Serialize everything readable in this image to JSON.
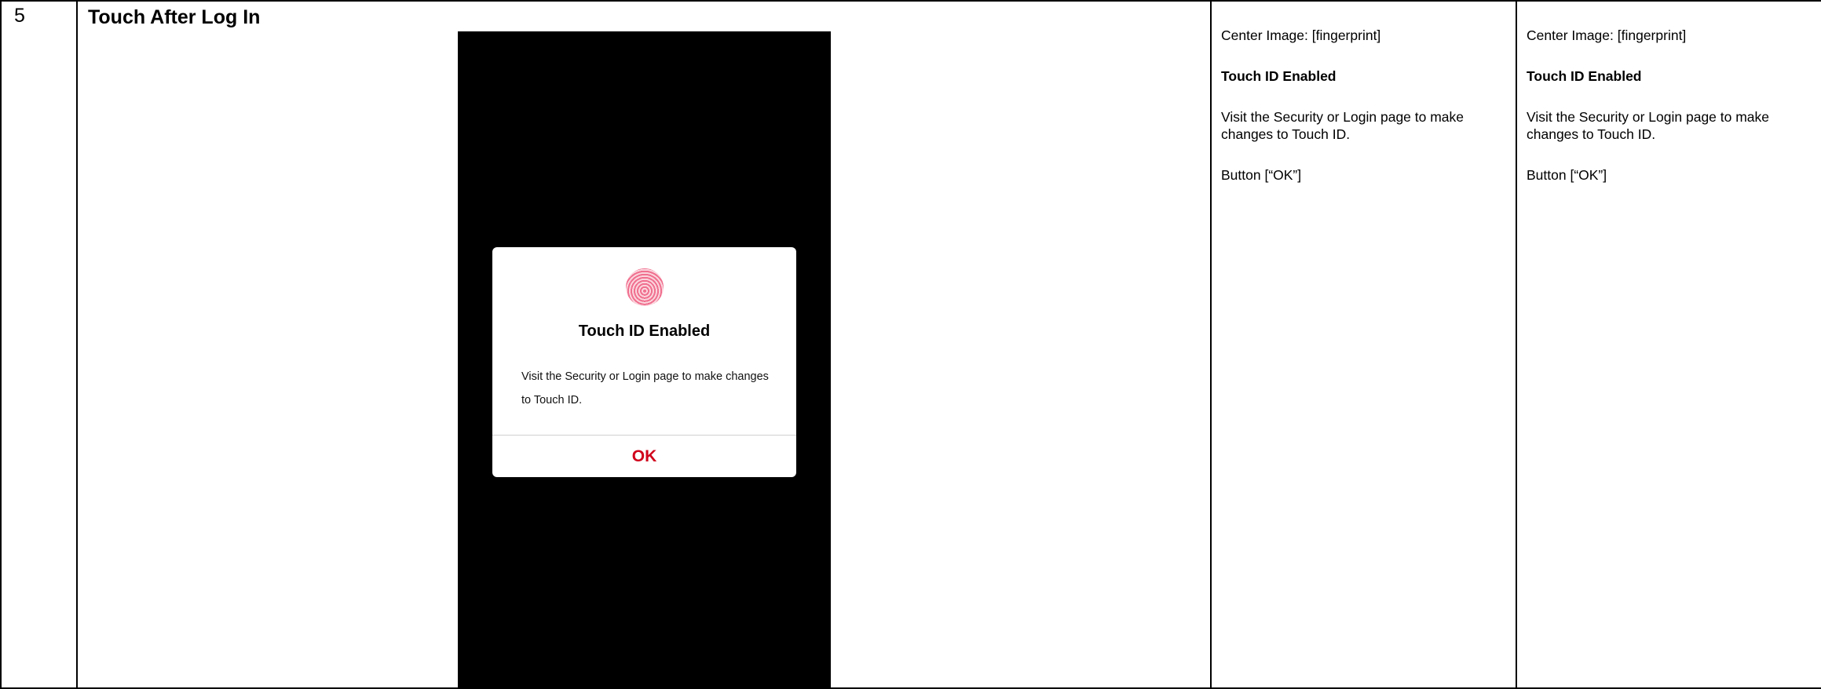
{
  "row": {
    "number": "5",
    "title": "Touch After Log In"
  },
  "screen": {
    "alert": {
      "icon": "fingerprint-icon",
      "title": "Touch ID Enabled",
      "message": "Visit the Security or Login page to make changes to Touch ID.",
      "ok_label": "OK"
    },
    "colors": {
      "background": "#000000",
      "ok": "#d0021b",
      "fingerprint": "#f07090"
    }
  },
  "spec_columns": [
    {
      "center_image": "Center Image: [fingerprint]",
      "heading": "Touch ID Enabled",
      "body": "Visit the Security or Login page to make changes to Touch ID.",
      "button": "Button [“OK”]"
    },
    {
      "center_image": "Center Image: [fingerprint]",
      "heading": "Touch ID Enabled",
      "body": "Visit the Security or Login page to make changes to Touch ID.",
      "button": "Button [“OK”]"
    }
  ]
}
